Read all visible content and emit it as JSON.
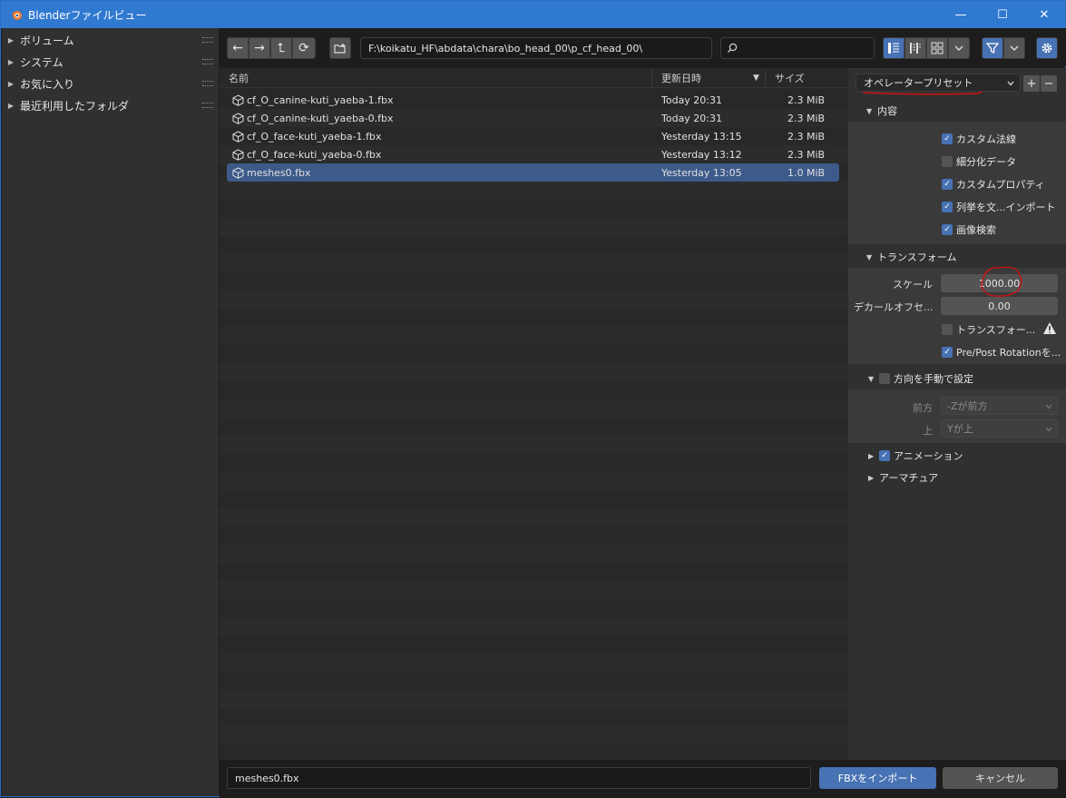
{
  "window": {
    "title": "Blenderファイルビュー",
    "minimize": "—",
    "maximize": "☐",
    "close": "✕"
  },
  "sidebar": {
    "items": [
      {
        "label": "ボリューム"
      },
      {
        "label": "システム"
      },
      {
        "label": "お気に入り"
      },
      {
        "label": "最近利用したフォルダ"
      }
    ]
  },
  "toolbar": {
    "back": "←",
    "forward": "→",
    "parent": "⮤",
    "refresh": "⟳",
    "path": "F:\\koikatu_HF\\abdata\\chara\\bo_head_00\\p_cf_head_00\\",
    "search_placeholder": ""
  },
  "filelist": {
    "columns": {
      "name": "名前",
      "date": "更新日時",
      "size": "サイズ",
      "sort_indicator": "▼"
    },
    "files": [
      {
        "name": "cf_O_canine-kuti_yaeba-1.fbx",
        "date": "Today 20:31",
        "size": "2.3 MiB"
      },
      {
        "name": "cf_O_canine-kuti_yaeba-0.fbx",
        "date": "Today 20:31",
        "size": "2.3 MiB"
      },
      {
        "name": "cf_O_face-kuti_yaeba-1.fbx",
        "date": "Yesterday 13:15",
        "size": "2.3 MiB"
      },
      {
        "name": "cf_O_face-kuti_yaeba-0.fbx",
        "date": "Yesterday 13:12",
        "size": "2.3 MiB"
      },
      {
        "name": "meshes0.fbx",
        "date": "Yesterday 13:05",
        "size": "1.0 MiB"
      }
    ],
    "selected_index": 4
  },
  "bottom": {
    "filename": "meshes0.fbx",
    "import_label": "FBXをインポート",
    "cancel_label": "キャンセル"
  },
  "props": {
    "preset": "オペレータープリセット",
    "add": "+",
    "remove": "−",
    "include": {
      "header": "内容",
      "custom_normals": "カスタム法線",
      "subdivision": "細分化データ",
      "custom_props": "カスタムプロパティ",
      "enum_import": "列挙を文...インポート",
      "image_search": "画像検索"
    },
    "transform": {
      "header": "トランスフォーム",
      "scale_label": "スケール",
      "scale_value": "1000.00",
      "decal_label": "デカールオフセ...",
      "decal_value": "0.00",
      "apply_transform": "トランスフォー...",
      "prepost": "Pre/Post Rotationを..."
    },
    "orientation": {
      "header": "方向を手動で設定",
      "forward_label": "前方",
      "forward_value": "-Zが前方",
      "up_label": "上",
      "up_value": "Yが上"
    },
    "animation": {
      "header": "アニメーション"
    },
    "armature": {
      "header": "アーマチュア"
    }
  }
}
